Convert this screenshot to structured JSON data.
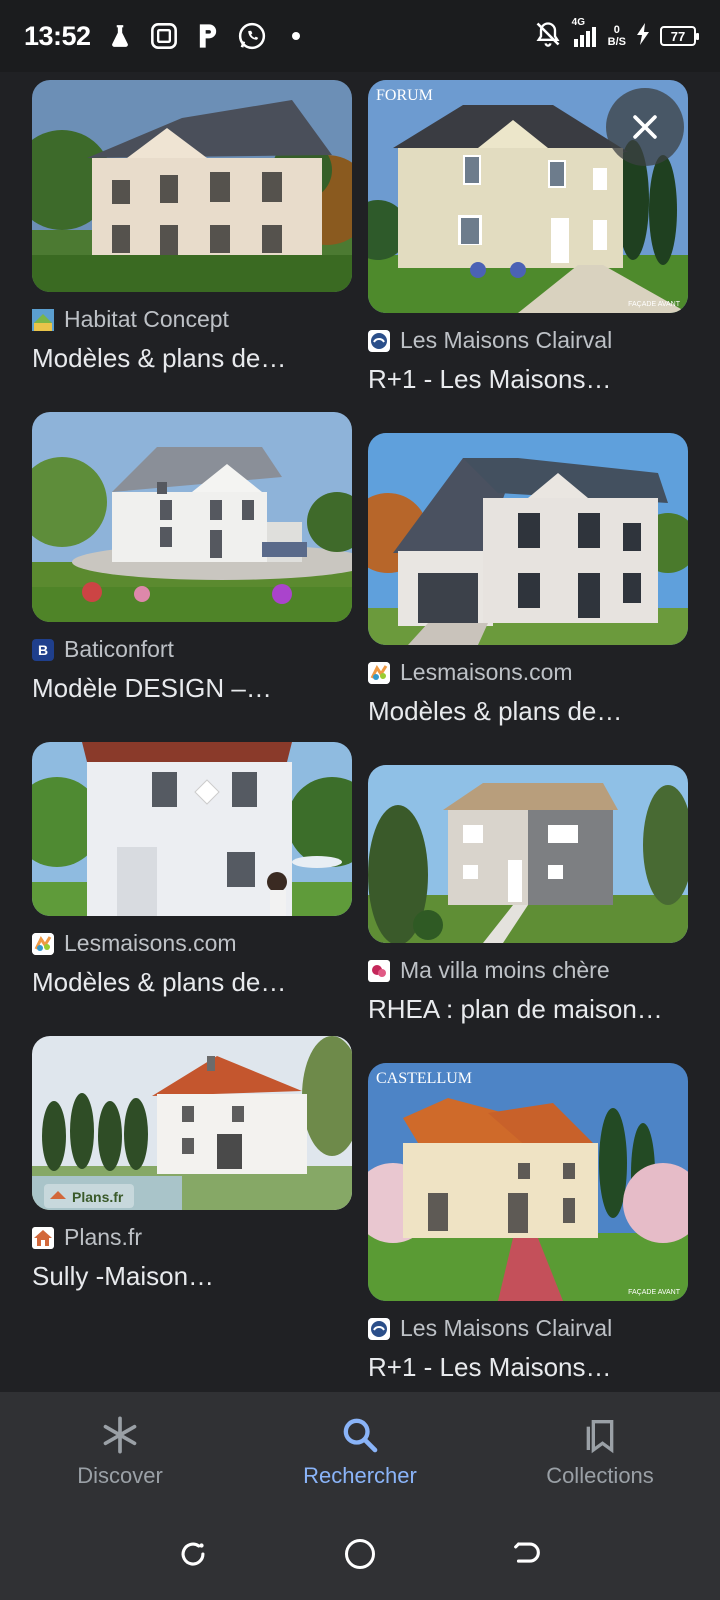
{
  "status": {
    "time": "13:52",
    "network": "4G",
    "speed_top": "0",
    "speed_bottom": "B/S",
    "battery": "77"
  },
  "results": {
    "left": [
      {
        "source": "Habitat Concept",
        "title": "Modèles & plans de…",
        "favicon_color": "#4a90c2"
      },
      {
        "source": "Baticonfort",
        "title": "Modèle DESIGN –…",
        "favicon_color": "#1f3f8c",
        "favicon_letter": "B"
      },
      {
        "source": "Lesmaisons.com",
        "title": "Modèles & plans de…",
        "favicon_color": "#f2f2f2"
      },
      {
        "source": "Plans.fr",
        "title": "Sully -Maison…",
        "favicon_color": "#f3f3f3"
      }
    ],
    "right": [
      {
        "source": "Les Maisons Clairval",
        "title": "R+1 - Les Maisons…",
        "favicon_color": "#2b4f8a",
        "overlay_text": "FORUM",
        "corner_text": "FAÇADE AVANT"
      },
      {
        "source": "Lesmaisons.com",
        "title": "Modèles & plans de…",
        "favicon_color": "#f2f2f2"
      },
      {
        "source": "Ma villa moins chère",
        "title": "RHEA : plan de maison…",
        "favicon_color": "#f4f4f4"
      },
      {
        "source": "Les Maisons Clairval",
        "title": "R+1 - Les Maisons…",
        "favicon_color": "#2b4f8a",
        "overlay_text": "CASTELLUM",
        "corner_text": "FAÇADE AVANT"
      }
    ],
    "watermark_plans": "Plans.fr"
  },
  "bottom_nav": {
    "discover": "Discover",
    "search": "Rechercher",
    "collections": "Collections",
    "active_color": "#8ab4f8"
  }
}
